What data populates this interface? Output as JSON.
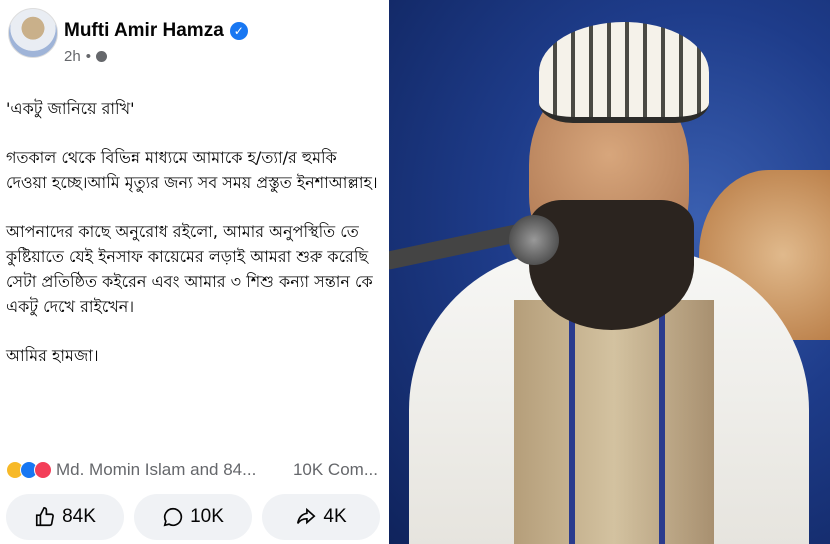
{
  "post": {
    "author": "Mufti Amir Hamza",
    "time": "2h",
    "separator": "•",
    "paragraphs": [
      "'একটু জানিয়ে রাখি'",
      "গতকাল থেকে বিভিন্ন মাধ্যমে আমাকে হ/ত্যা/র হুমকি দেওয়া হচ্ছে।আমি মৃত্যুর জন্য সব সময় প্রস্তুত ইনশাআল্লাহ।",
      "আপনাদের কাছে অনুরোধ রইলো, আমার অনুপস্থিতি তে কুষ্টিয়াতে যেই ইনসাফ কায়েমের লড়াই আমরা শুরু করেছি সেটা প্রতিষ্ঠিত কইরেন এবং আমার ৩ শিশু কন্যা সন্তান কে একটু দেখে রাইখেন।",
      "আমির হামজা।"
    ],
    "reactions_text": "Md. Momin Islam and 84...",
    "comments_text": "10K Com..."
  },
  "actions": {
    "like_count": "84K",
    "comment_count": "10K",
    "share_count": "4K"
  },
  "icons": {
    "verified": "verified-badge-icon",
    "privacy": "globe-icon",
    "like": "thumbs-up-icon",
    "comment": "comment-bubble-icon",
    "share": "share-arrow-icon"
  },
  "colors": {
    "verified": "#1877f2",
    "meta_text": "#65676b",
    "button_bg": "#f0f2f5"
  }
}
